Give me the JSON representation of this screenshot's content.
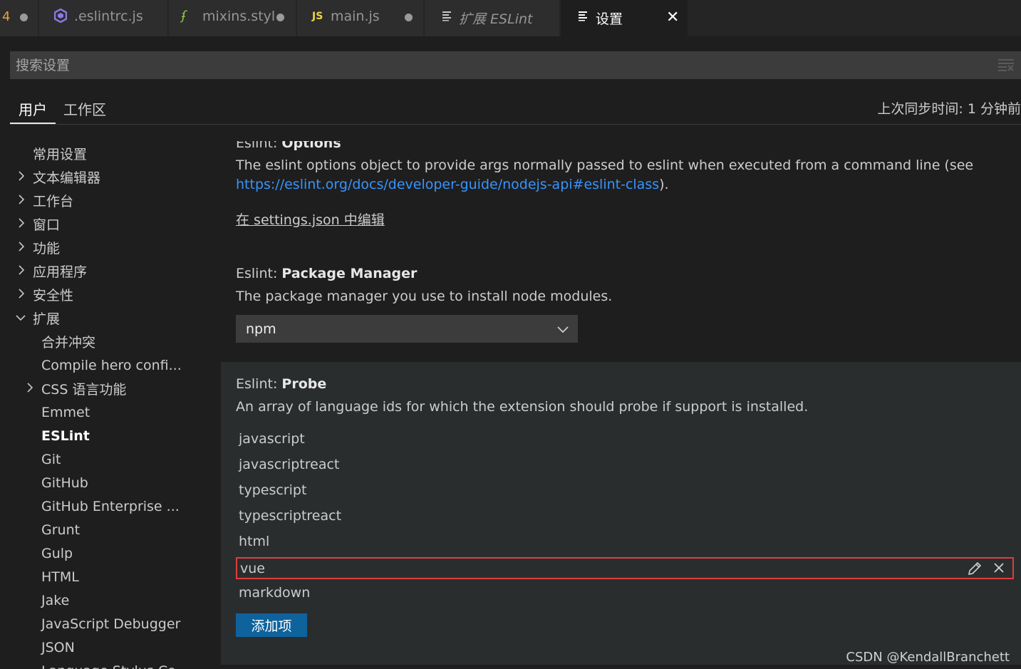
{
  "tabs": [
    {
      "badge": "4"
    },
    {
      "icon": "eslint-icon",
      "label": ".eslintrc.js"
    },
    {
      "icon": "stylus-icon",
      "label": "mixins.styl"
    },
    {
      "icon_text": "JS",
      "label": "main.js"
    },
    {
      "icon": "preview-icon",
      "label": "扩展 ESLint"
    },
    {
      "icon": "preview-icon",
      "label": "设置",
      "close": "✕"
    }
  ],
  "search": {
    "placeholder": "搜索设置"
  },
  "scope_tabs": {
    "user": "用户",
    "workspace": "工作区",
    "sync_status": "上次同步时间: 1 分钟前"
  },
  "sidebar": [
    {
      "label": "常用设置",
      "chevron": "none"
    },
    {
      "label": "文本编辑器",
      "chevron": "right"
    },
    {
      "label": "工作台",
      "chevron": "right"
    },
    {
      "label": "窗口",
      "chevron": "right"
    },
    {
      "label": "功能",
      "chevron": "right"
    },
    {
      "label": "应用程序",
      "chevron": "right"
    },
    {
      "label": "安全性",
      "chevron": "right"
    },
    {
      "label": "扩展",
      "chevron": "down"
    },
    {
      "label": "合并冲突",
      "chevron": "none"
    },
    {
      "label": "Compile hero confi...",
      "chevron": "none"
    },
    {
      "label": "CSS 语言功能",
      "chevron": "right"
    },
    {
      "label": "Emmet",
      "chevron": "none"
    },
    {
      "label": "ESLint",
      "chevron": "none",
      "bold": true
    },
    {
      "label": "Git",
      "chevron": "none"
    },
    {
      "label": "GitHub",
      "chevron": "none"
    },
    {
      "label": "GitHub Enterprise ...",
      "chevron": "none"
    },
    {
      "label": "Grunt",
      "chevron": "none"
    },
    {
      "label": "Gulp",
      "chevron": "none"
    },
    {
      "label": "HTML",
      "chevron": "none"
    },
    {
      "label": "Jake",
      "chevron": "none"
    },
    {
      "label": "JavaScript Debugger",
      "chevron": "none"
    },
    {
      "label": "JSON",
      "chevron": "none"
    },
    {
      "label": "Language Stylus Co...",
      "chevron": "none"
    }
  ],
  "options_setting": {
    "category": "Eslint: ",
    "key": "Options",
    "desc_prefix": "The eslint options object to provide args normally passed to eslint when executed from a command line (see",
    "desc_link": "https://eslint.org/docs/developer-guide/nodejs-api#eslint-class",
    "desc_suffix": ").",
    "edit_link": "在 settings.json 中编辑"
  },
  "package_manager_setting": {
    "category": "Eslint: ",
    "key": "Package Manager",
    "description": "The package manager you use to install node modules.",
    "value": "npm"
  },
  "probe_setting": {
    "category": "Eslint: ",
    "key": "Probe",
    "description": "An array of language ids for which the extension should probe if support is installed.",
    "items": [
      "javascript",
      "javascriptreact",
      "typescript",
      "typescriptreact",
      "html",
      "vue",
      "markdown"
    ],
    "selected_index": 5,
    "add_button": "添加项"
  },
  "watermark": "CSDN @KendallBranchett",
  "colors": {
    "accent_button": "#0e639c",
    "link": "#3794ff",
    "selection_border": "#e03c3c",
    "background": "#1e1e1e"
  }
}
